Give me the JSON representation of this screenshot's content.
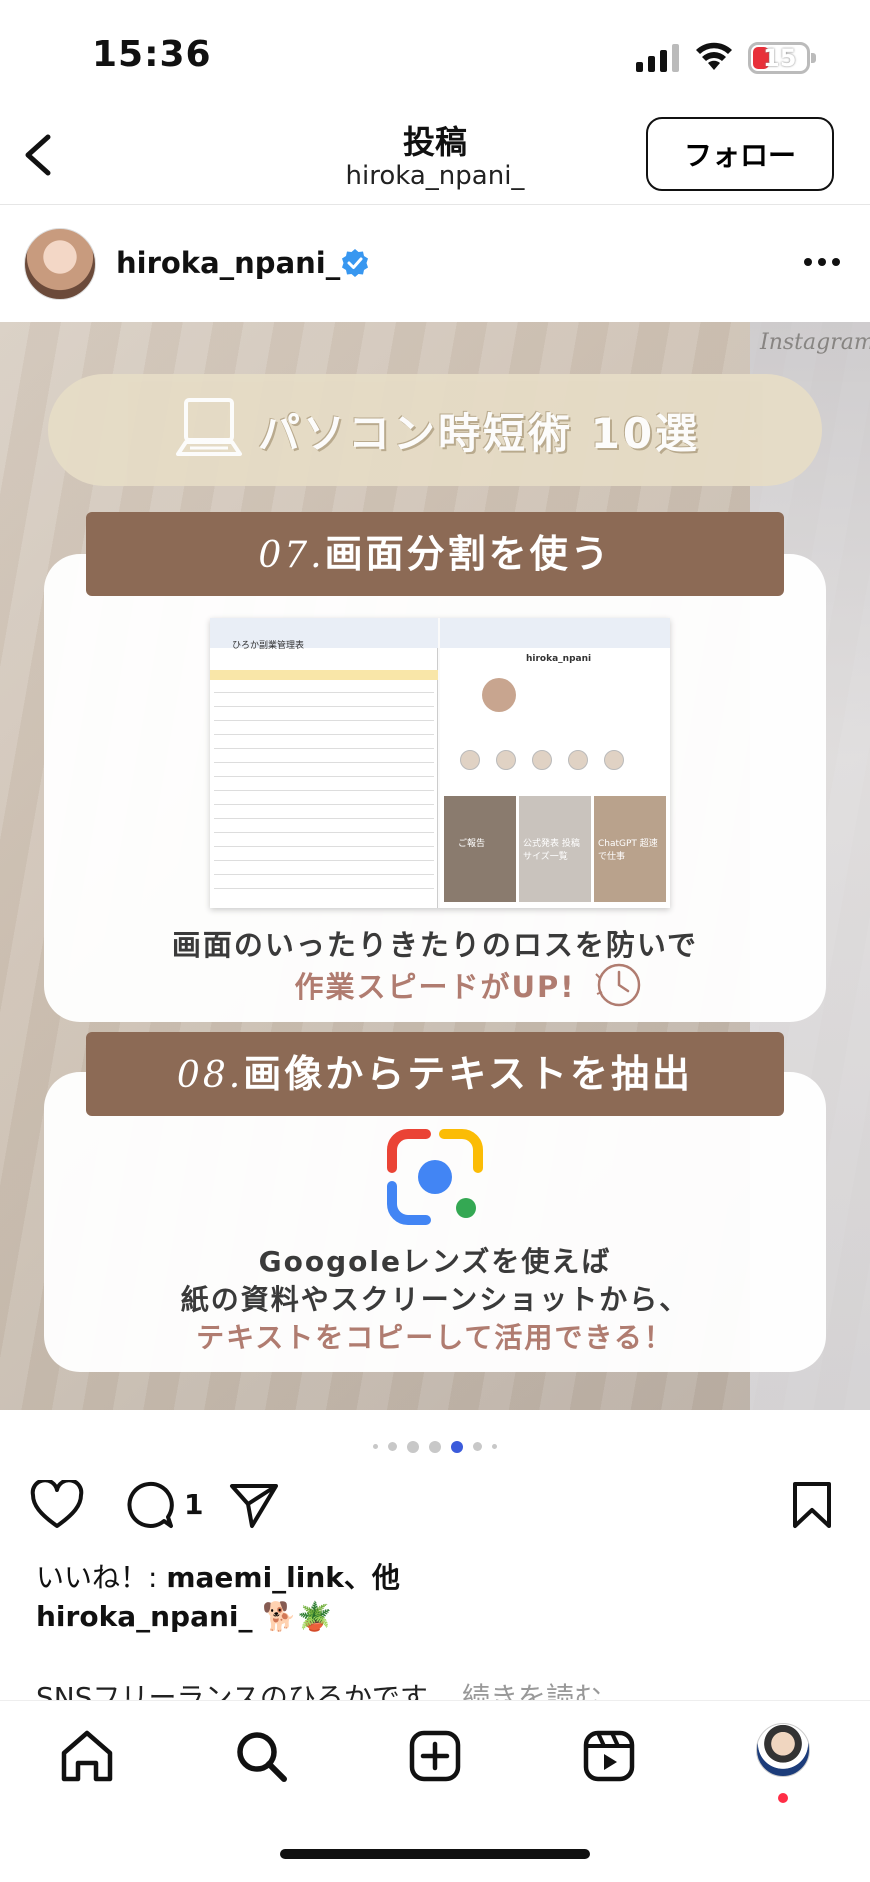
{
  "status_bar": {
    "time": "15:36",
    "battery": "15",
    "battery_color": "#e8303a"
  },
  "header": {
    "title": "投稿",
    "subtitle": "hiroka_npani_",
    "follow_label": "フォロー"
  },
  "post": {
    "username": "hiroka_npani_",
    "verified": true,
    "image": {
      "watermark": "Instagram",
      "title": "パソコン時短術 10選",
      "tip7": {
        "num": "07.",
        "heading": "画面分割を使う",
        "line1": "画面のいったりきたりのロスを防いで",
        "line2": "作業スピードがUP!"
      },
      "tip8": {
        "num": "08.",
        "heading": "画像からテキストを抽出",
        "line1": "Googoleレンズを使えば",
        "line2": "紙の資料やスクリーンショットから、",
        "line3": "テキストをコピーして活用できる！"
      },
      "screenshot_labels": {
        "sheet_title": "ひろか副業管理表",
        "profile_name": "hiroka_npani",
        "tile1": "ご報告",
        "tile2": "公式発表 投稿サイズ一覧",
        "tile3": "ChatGPT 超速で仕事"
      }
    },
    "carousel": {
      "total": 7,
      "active_index": 4,
      "active_color": "#3b5bdb"
    },
    "comment_count": "1",
    "likes": {
      "prefix": "いいね！: ",
      "text": "maemi_link、他"
    },
    "caption_user": "hiroka_npani_",
    "caption_emoji": "🐕🪴",
    "caption_text": "SNSフリーランスのひろかです。",
    "caption_more": "続きを読む"
  },
  "tabbar": {
    "items": [
      "home",
      "search",
      "create",
      "reels",
      "profile"
    ]
  },
  "colors": {
    "accent_brown": "#8c6a55",
    "pink_text": "#b07c70",
    "verified_blue": "#3897f0"
  }
}
